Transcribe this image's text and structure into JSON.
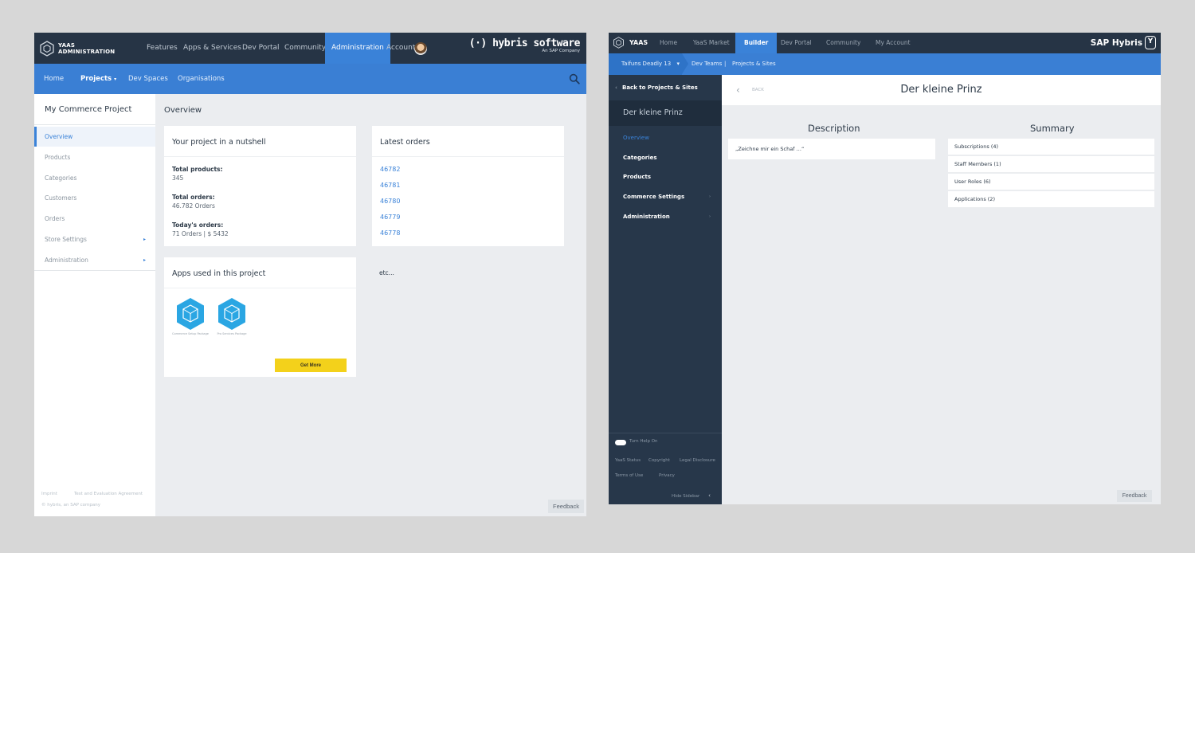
{
  "left": {
    "brand": [
      "YAAS",
      "ADMINISTRATION"
    ],
    "top_nav": [
      "Features",
      "Apps & Services",
      "Dev Portal",
      "Community",
      "Administration",
      "Account"
    ],
    "hybris": {
      "main": "(·) hybris software",
      "sub": "An SAP Company"
    },
    "sub_nav": [
      "Home",
      "Projects",
      "Dev Spaces",
      "Organisations"
    ],
    "sidebar": {
      "title": "My Commerce Project",
      "items": [
        "Overview",
        "Products",
        "Categories",
        "Customers",
        "Orders",
        "Store Settings",
        "Administration"
      ],
      "footer": [
        "Imprint",
        "Test and Evaluation Agreement",
        "© hybris, an SAP company"
      ]
    },
    "main": {
      "title": "Overview",
      "nutshell": {
        "title": "Your project in a nutshell",
        "total_products_label": "Total products:",
        "total_products_value": "345",
        "total_orders_label": "Total orders:",
        "total_orders_value": "46.782 Orders",
        "todays_orders_label": "Today's orders:",
        "todays_orders_value": "71 Orders  |  $ 5432"
      },
      "orders": {
        "title": "Latest orders",
        "items": [
          "46782",
          "46781",
          "46780",
          "46779",
          "46778"
        ]
      },
      "apps": {
        "title": "Apps used in this project",
        "captions": [
          "Commerce Setup Package",
          "Pro Services Package"
        ],
        "get_more": "Get More"
      },
      "etc": "etc...",
      "feedback": "Feedback"
    }
  },
  "right": {
    "brand": "YAAS",
    "top_nav": [
      "Home",
      "YaaS Market",
      "Builder",
      "Dev Portal",
      "Community",
      "My Account"
    ],
    "sap": "SAP Hybris",
    "breadcrumb": [
      "Taifuns Deadly 13",
      "Dev Teams",
      "|",
      "Projects & Sites"
    ],
    "sidebar": {
      "back": "Back to Projects & Sites",
      "project": "Der kleine Prinz",
      "items": [
        "Overview",
        "Categories",
        "Products",
        "Commerce Settings",
        "Administration"
      ],
      "help": "Turn Help On",
      "footer_row1": [
        "YaaS Status",
        "Copyright",
        "Legal Disclosure"
      ],
      "footer_row2": [
        "Terms of Use",
        "Privacy"
      ],
      "hide": "Hide Sidebar"
    },
    "header": {
      "back": "BACK",
      "title": "Der kleine Prinz"
    },
    "description": {
      "title": "Description",
      "text": "„Zeichne mir ein Schaf …“"
    },
    "summary": {
      "title": "Summary",
      "rows": [
        "Subscriptions (4)",
        "Staff Members (1)",
        "User Roles (6)",
        "Applications (2)"
      ]
    },
    "feedback": "Feedback"
  },
  "colors": {
    "nav_dark": "#263445",
    "accent_blue": "#3a82d8",
    "yellow": "#f3d11b",
    "sidebar_dark": "#27374a"
  }
}
